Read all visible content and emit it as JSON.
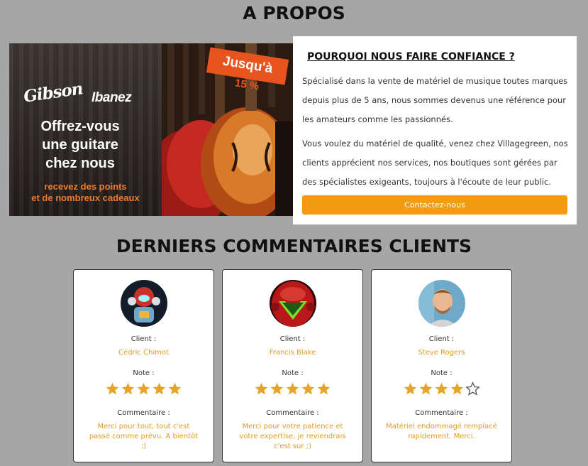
{
  "about": {
    "title": "A PROPOS",
    "banner": {
      "brand_1": "Gibson",
      "brand_2": "Ibanez",
      "headline_lines": [
        "Offrez-vous",
        "une guitare",
        "chez nous"
      ],
      "subline_lines": [
        "recevez des points",
        "et de nombreux cadeaux"
      ],
      "promo_tag": "Jusqu'à",
      "promo_percent": "15 %"
    },
    "card": {
      "heading": "POURQUOI NOUS FAIRE CONFIANCE ?",
      "paragraph_1": "Spécialisé dans la vente de matériel de musique toutes marques depuis plus de 5 ans, nous sommes devenus une référence pour les amateurs comme les passionnés.",
      "paragraph_2": "Vous voulez du matériel de qualité, venez chez Villagegreen, nos clients apprécient nos services, nos boutiques sont gérées par des spécialistes exigeants, toujours à l'écoute de leur public.",
      "button_label": "Contactez-nous"
    }
  },
  "reviews": {
    "title": "DERNIERS COMMENTAIRES CLIENTS",
    "client_label": "Client :",
    "note_label": "Note :",
    "comment_label": "Commentaire :",
    "items": [
      {
        "name": "Cédric Chimot",
        "rating": 5,
        "comment": "Merci pour tout, tout c'est passé comme prévu. A bientôt ;)",
        "avatar_icon": "robot-avatar-icon"
      },
      {
        "name": "Francis Blake",
        "rating": 5,
        "comment": "Merci pour votre patience et votre expertise, je reviendrais c'est sur ;)",
        "avatar_icon": "helmet-avatar-icon"
      },
      {
        "name": "Steve Rogers",
        "rating": 4,
        "comment": "Matériel endommagé remplacé rapidement. Merci.",
        "avatar_icon": "man-avatar-icon"
      }
    ]
  },
  "colors": {
    "accent": "#f39c12",
    "star": "#e5a42a",
    "name_text": "#e39a1f",
    "promo": "#e8541e"
  }
}
